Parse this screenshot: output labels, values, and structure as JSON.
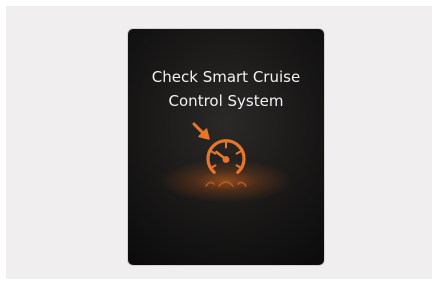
{
  "warning": {
    "line1": "Check Smart Cruise",
    "line2": "Control System",
    "icon": "smart-cruise-speedometer-icon",
    "icon_color": "#e8762a",
    "text_color": "#f2f2f2",
    "screen_color": "#1a1a1a",
    "background_color": "#f1eef0"
  }
}
